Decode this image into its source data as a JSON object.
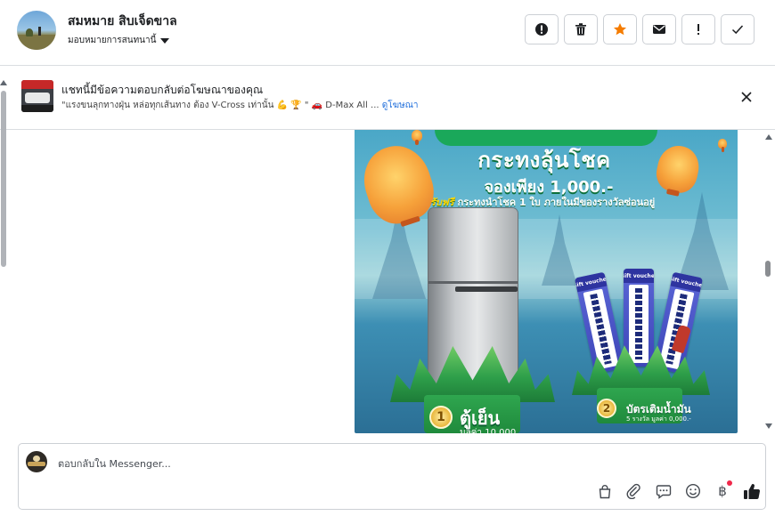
{
  "header": {
    "contact_name": "สมหมาย สิบเจ็ดขาล",
    "assign_label": "มอบหมายการสนทนานี้"
  },
  "actions": [
    {
      "name": "spam-button",
      "icon": "alert-circle-icon"
    },
    {
      "name": "delete-button",
      "icon": "trash-icon"
    },
    {
      "name": "star-button",
      "icon": "star-icon"
    },
    {
      "name": "mark-unread-button",
      "icon": "envelope-icon"
    },
    {
      "name": "follow-up-button",
      "icon": "exclamation-icon"
    },
    {
      "name": "done-button",
      "icon": "checkmark-icon"
    }
  ],
  "ad_banner": {
    "title": "แชทนี้มีข้อความตอบกลับต่อโฆษณาของคุณ",
    "preview": "\"แรงขนลุกทางฝุ่น หล่อทุกเส้นทาง ต้อง V-Cross เท่านั้น 💪 🏆 \" 🚗 D-Max All ...",
    "link": "ดูโฆษณา"
  },
  "promo_image": {
    "headline": "กระทงลุ้นโชค",
    "price_line": "จองเพียง 1,000.-",
    "free_label": "รับฟรี",
    "free_text": "กระทงนำโชค 1 ใบ ภายในมีของรางวัลซ่อนอยู่",
    "prize1_number": "1",
    "prize1_name": "ตู้เย็น",
    "prize1_value": "มูลค่า 10,000",
    "prize2_number": "2",
    "prize2_name": "บัตรเติมน้ำมัน",
    "prize2_value": "5 รางวัล มูลค่า 0,000.-",
    "voucher_label": "Gift voucher"
  },
  "composer": {
    "placeholder": "ตอบกลับใน Messenger...",
    "tools": [
      "bag-icon",
      "paperclip-icon",
      "chat-bubble-icon",
      "smiley-icon",
      "baht-icon",
      "thumbs-up-icon"
    ],
    "baht_symbol": "฿"
  },
  "colors": {
    "star": "#f57c00",
    "link": "#216fdb",
    "like": "#1c1e21",
    "notification_dot": "#f0284a"
  }
}
